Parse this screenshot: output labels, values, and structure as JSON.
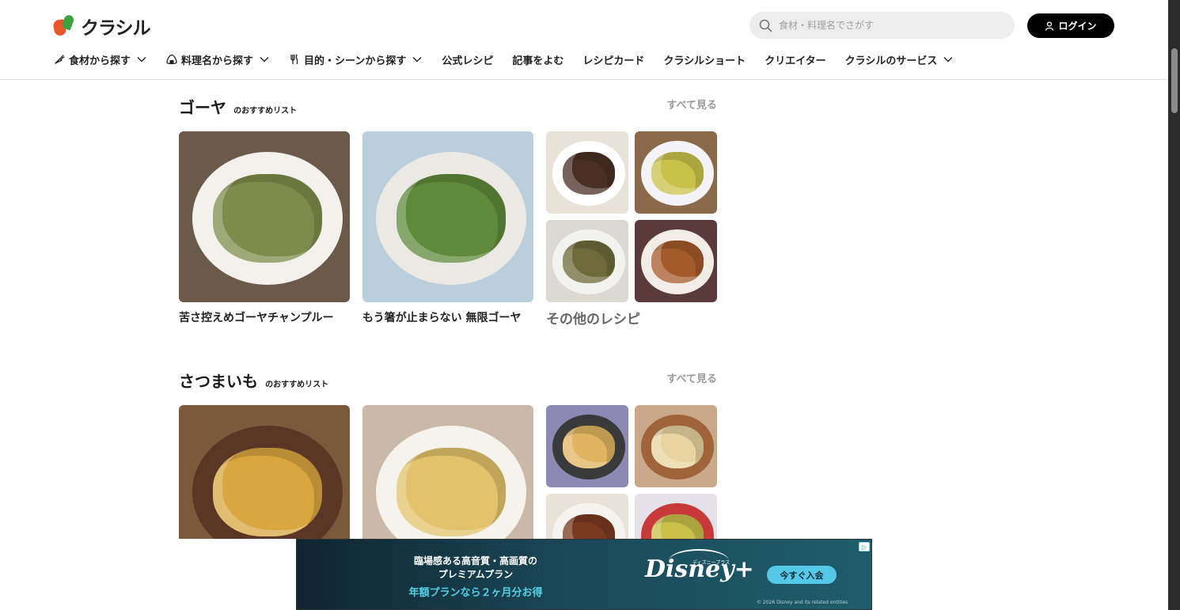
{
  "header": {
    "logo_text": "クラシル",
    "search_placeholder": "食材・料理名でさがす",
    "login_label": "ログイン"
  },
  "nav": [
    {
      "label": "食材から探す",
      "icon": "carrot-icon",
      "dropdown": true
    },
    {
      "label": "料理名から探す",
      "icon": "onigiri-icon",
      "dropdown": true
    },
    {
      "label": "目的・シーンから探す",
      "icon": "fork-icon",
      "dropdown": true
    },
    {
      "label": "公式レシピ",
      "dropdown": false
    },
    {
      "label": "記事をよむ",
      "dropdown": false
    },
    {
      "label": "レシピカード",
      "dropdown": false
    },
    {
      "label": "クラシルショート",
      "dropdown": false
    },
    {
      "label": "クリエイター",
      "dropdown": false
    },
    {
      "label": "クラシルのサービス",
      "dropdown": true
    }
  ],
  "sections": [
    {
      "title": "ゴーヤ",
      "subtitle": "のおすすめリスト",
      "see_all": "すべて見る",
      "cards": [
        {
          "caption": "苦さ控えめゴーヤチャンプルー"
        },
        {
          "caption": "もう箸が止まらない 無限ゴーヤ"
        }
      ],
      "other_label": "その他のレシピ"
    },
    {
      "title": "さつまいも",
      "subtitle": "のおすすめリスト",
      "see_all": "すべて見る"
    }
  ],
  "ad": {
    "line1": "臨場感ある高音質・高画質の",
    "line2": "プレミアムプラン",
    "line3": "年額プランなら２ヶ月分お得",
    "brand": "Disney+",
    "brand_sub": "ディズニープラス",
    "cta": "今すぐ入会",
    "copyright": "© 2026 Disney and its related entities"
  },
  "colors": {
    "accent": "#000000",
    "ad_cyan": "#54c8e6",
    "logo_orange": "#e9572b",
    "logo_green": "#3aa33f"
  }
}
